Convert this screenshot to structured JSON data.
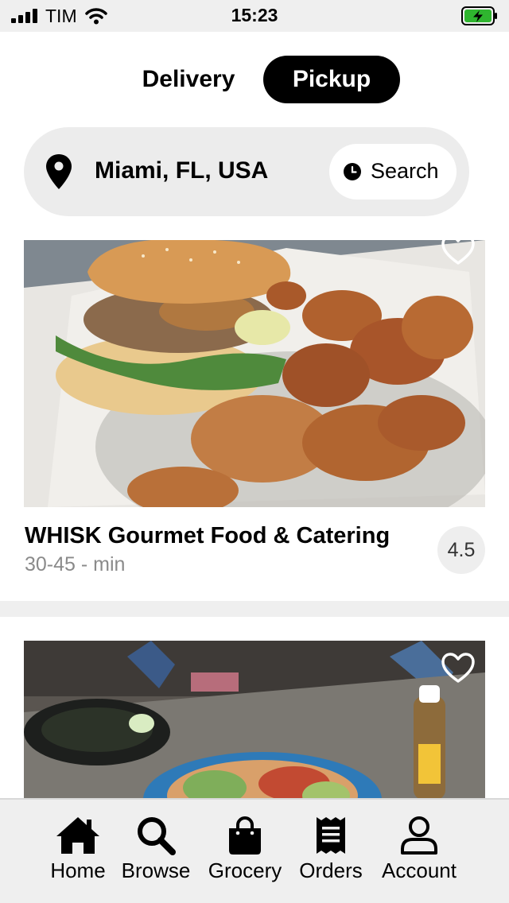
{
  "status_bar": {
    "carrier": "TIM",
    "time": "15:23",
    "icons": [
      "signal-icon",
      "wifi-icon",
      "battery-charging-icon"
    ],
    "battery_color": "#2fb52f"
  },
  "mode_switch": {
    "options": [
      "Delivery",
      "Pickup"
    ],
    "selected": "Pickup"
  },
  "location": {
    "icon": "location-pin-icon",
    "value": "Miami, FL, USA",
    "search_icon": "clock-icon",
    "search_label": "Search"
  },
  "restaurants": [
    {
      "name": "WHISK Gourmet Food & Catering",
      "eta": "30-45 - min",
      "rating": "4.5",
      "image": "burger-with-chips-photo",
      "favorite_icon": "heart-outline-icon"
    },
    {
      "name": "",
      "image": "tacos-on-table-photo",
      "favorite_icon": "heart-outline-icon"
    }
  ],
  "tab_bar": {
    "tabs": [
      {
        "label": "Home",
        "icon": "home-icon"
      },
      {
        "label": "Browse",
        "icon": "search-icon"
      },
      {
        "label": "Grocery",
        "icon": "shopping-bag-icon"
      },
      {
        "label": "Orders",
        "icon": "receipt-icon"
      },
      {
        "label": "Account",
        "icon": "person-icon"
      }
    ]
  },
  "colors": {
    "accent": "#000000",
    "background": "#ffffff",
    "muted_background": "#ececec",
    "muted_text": "#8a8a8a"
  }
}
